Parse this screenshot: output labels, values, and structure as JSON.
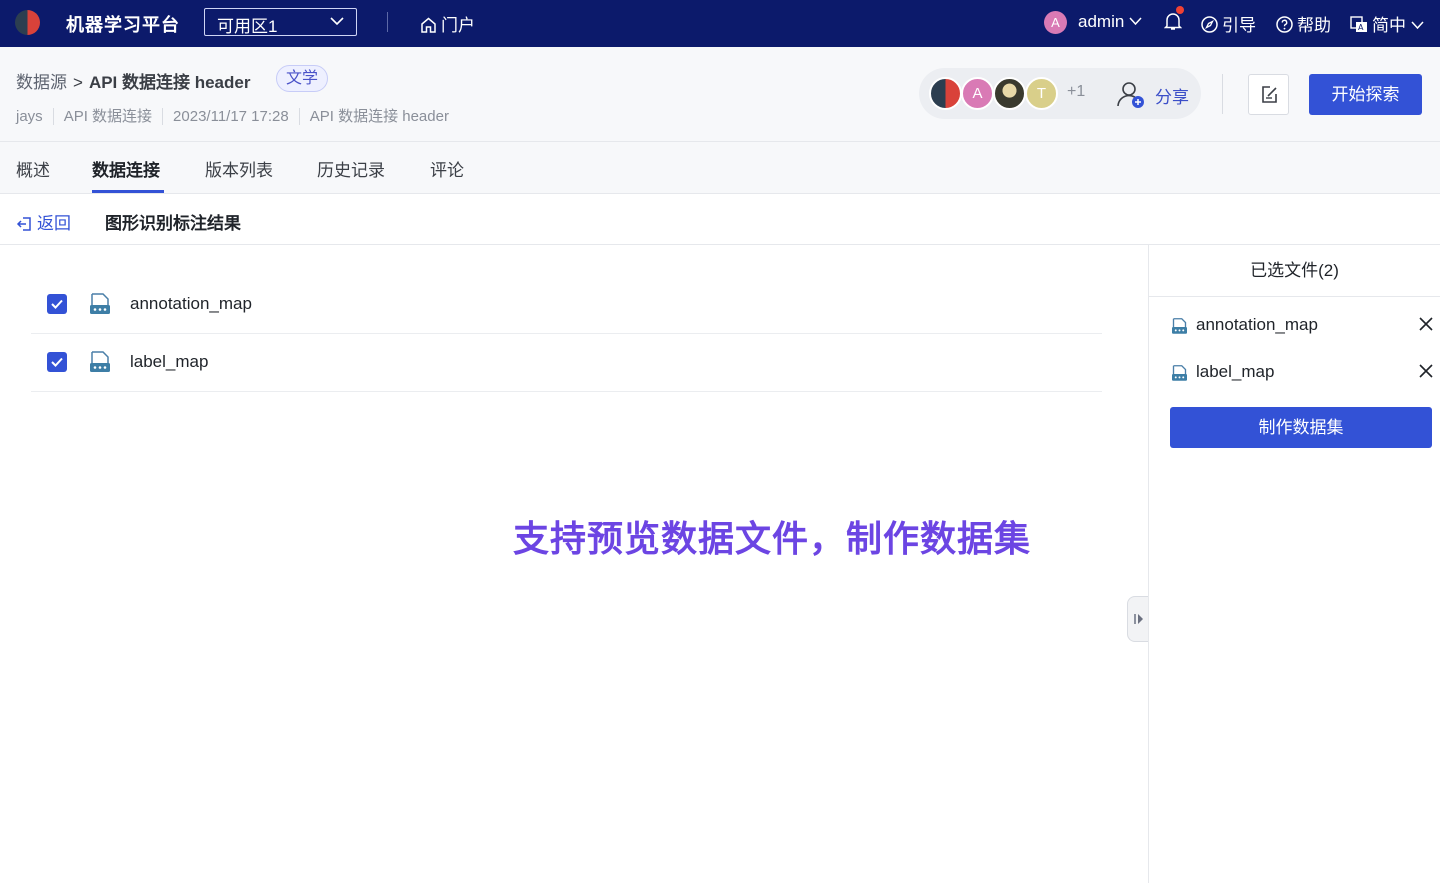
{
  "topbar": {
    "app_title": "机器学习平台",
    "zone_select": "可用区1",
    "portal": "门户",
    "user_initial": "A",
    "user_name": "admin",
    "guide": "引导",
    "help": "帮助",
    "language": "简中"
  },
  "page": {
    "breadcrumb_root": "数据源",
    "breadcrumb_sep": ">",
    "title": "API 数据连接 header",
    "tag": "文学",
    "meta": [
      "jays",
      "API 数据连接",
      "2023/11/17 17:28",
      "API 数据连接 header"
    ],
    "collaborators": [
      {
        "initial": "",
        "color": "#2c3e50"
      },
      {
        "initial": "A",
        "color": "#d97ab5"
      },
      {
        "initial": "",
        "color": "#3a3a2e"
      },
      {
        "initial": "T",
        "color": "#d9cf8a"
      }
    ],
    "more_count": "+1",
    "share": "分享",
    "explore_button": "开始探索"
  },
  "tabs": [
    "概述",
    "数据连接",
    "版本列表",
    "历史记录",
    "评论"
  ],
  "active_tab": "数据连接",
  "subheader": {
    "back": "返回",
    "title": "图形识别标注结果"
  },
  "files": [
    {
      "name": "annotation_map",
      "checked": true
    },
    {
      "name": "label_map",
      "checked": true
    }
  ],
  "banner": "支持预览数据文件，制作数据集",
  "right_panel": {
    "title": "已选文件(2)",
    "selected": [
      "annotation_map",
      "label_map"
    ],
    "make_button": "制作数据集"
  },
  "colors": {
    "topbar_bg": "#0c1a6b",
    "primary": "#3352d6",
    "banner": "#6c45e3"
  }
}
